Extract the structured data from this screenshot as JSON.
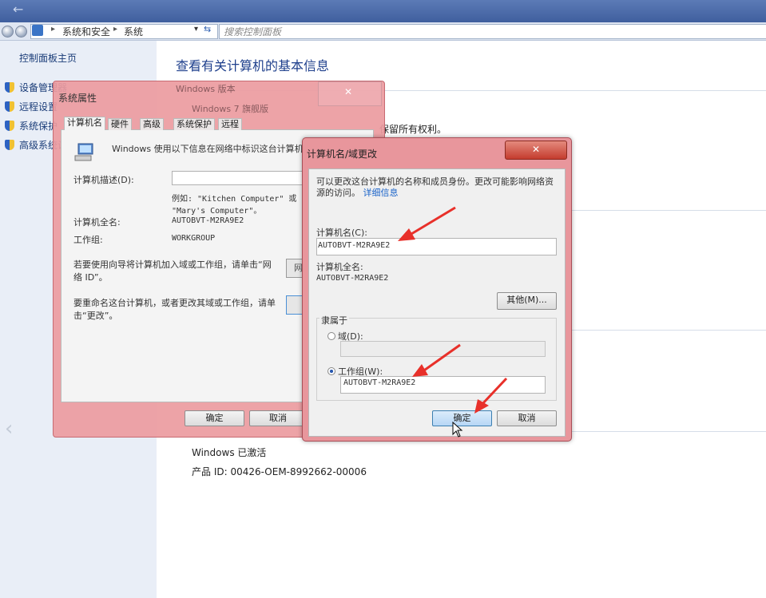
{
  "explorer": {
    "breadcrumb": [
      "系统和安全",
      "系统"
    ],
    "search_placeholder": "搜索控制面板"
  },
  "sidebar": {
    "home": "控制面板主页",
    "items": [
      {
        "label": "设备管理器",
        "icon": "shield-icon"
      },
      {
        "label": "远程设置",
        "icon": "shield-icon"
      },
      {
        "label": "系统保护",
        "icon": "shield-icon"
      },
      {
        "label": "高级系统设置",
        "icon": "shield-icon"
      }
    ]
  },
  "main": {
    "title": "查看有关计算机的基本信息",
    "rights_fragment": "保留所有权利。",
    "activation": "Windows 已激活",
    "product_id": "产品 ID: 00426-OEM-8992662-00006",
    "ghost_section": "Windows 版本",
    "ghost_edition": "Windows 7 旗舰版"
  },
  "system_properties": {
    "title": "系统属性",
    "close": "✕",
    "tabs": [
      "计算机名",
      "硬件",
      "高级",
      "系统保护",
      "远程"
    ],
    "intro": "Windows 使用以下信息在网络中标识这台计算机",
    "desc_label": "计算机描述(D):",
    "desc_example": "例如: \"Kitchen Computer\" 或 \"Mary's Computer\"。",
    "desc_example_line2": "Computer\"。",
    "full_name_label": "计算机全名:",
    "full_name_value": "AUTOBVT-M2RA9E2",
    "workgroup_label": "工作组:",
    "workgroup_value": "WORKGROUP",
    "netid_text": "若要使用向导将计算机加入域或工作组，请单击“网络 ID”。",
    "netid_button": "网络",
    "rename_text": "要重命名这台计算机，或者更改其域或工作组，请单击“更改”。",
    "ok": "确定",
    "cancel": "取消"
  },
  "computer_name_dialog": {
    "title": "计算机名/域更改",
    "close": "✕",
    "description": "可以更改这台计算机的名称和成员身份。更改可能影响网络资源的访问。",
    "link": "详细信息",
    "name_label": "计算机名(C):",
    "name_value": "AUTOBVT-M2RA9E2",
    "full_name_label": "计算机全名:",
    "full_name_value": "AUTOBVT-M2RA9E2",
    "more_button": "其他(M)...",
    "member_of": "隶属于",
    "domain_label": "域(D):",
    "domain_value": "",
    "workgroup_label": "工作组(W):",
    "workgroup_value": "AUTOBVT-M2RA9E2",
    "selected_membership": "workgroup",
    "ok": "确定",
    "cancel": "取消"
  },
  "colors": {
    "annotation_arrow": "#e8302a",
    "dialog_frame": "#e8969c",
    "link": "#1a63c9"
  }
}
